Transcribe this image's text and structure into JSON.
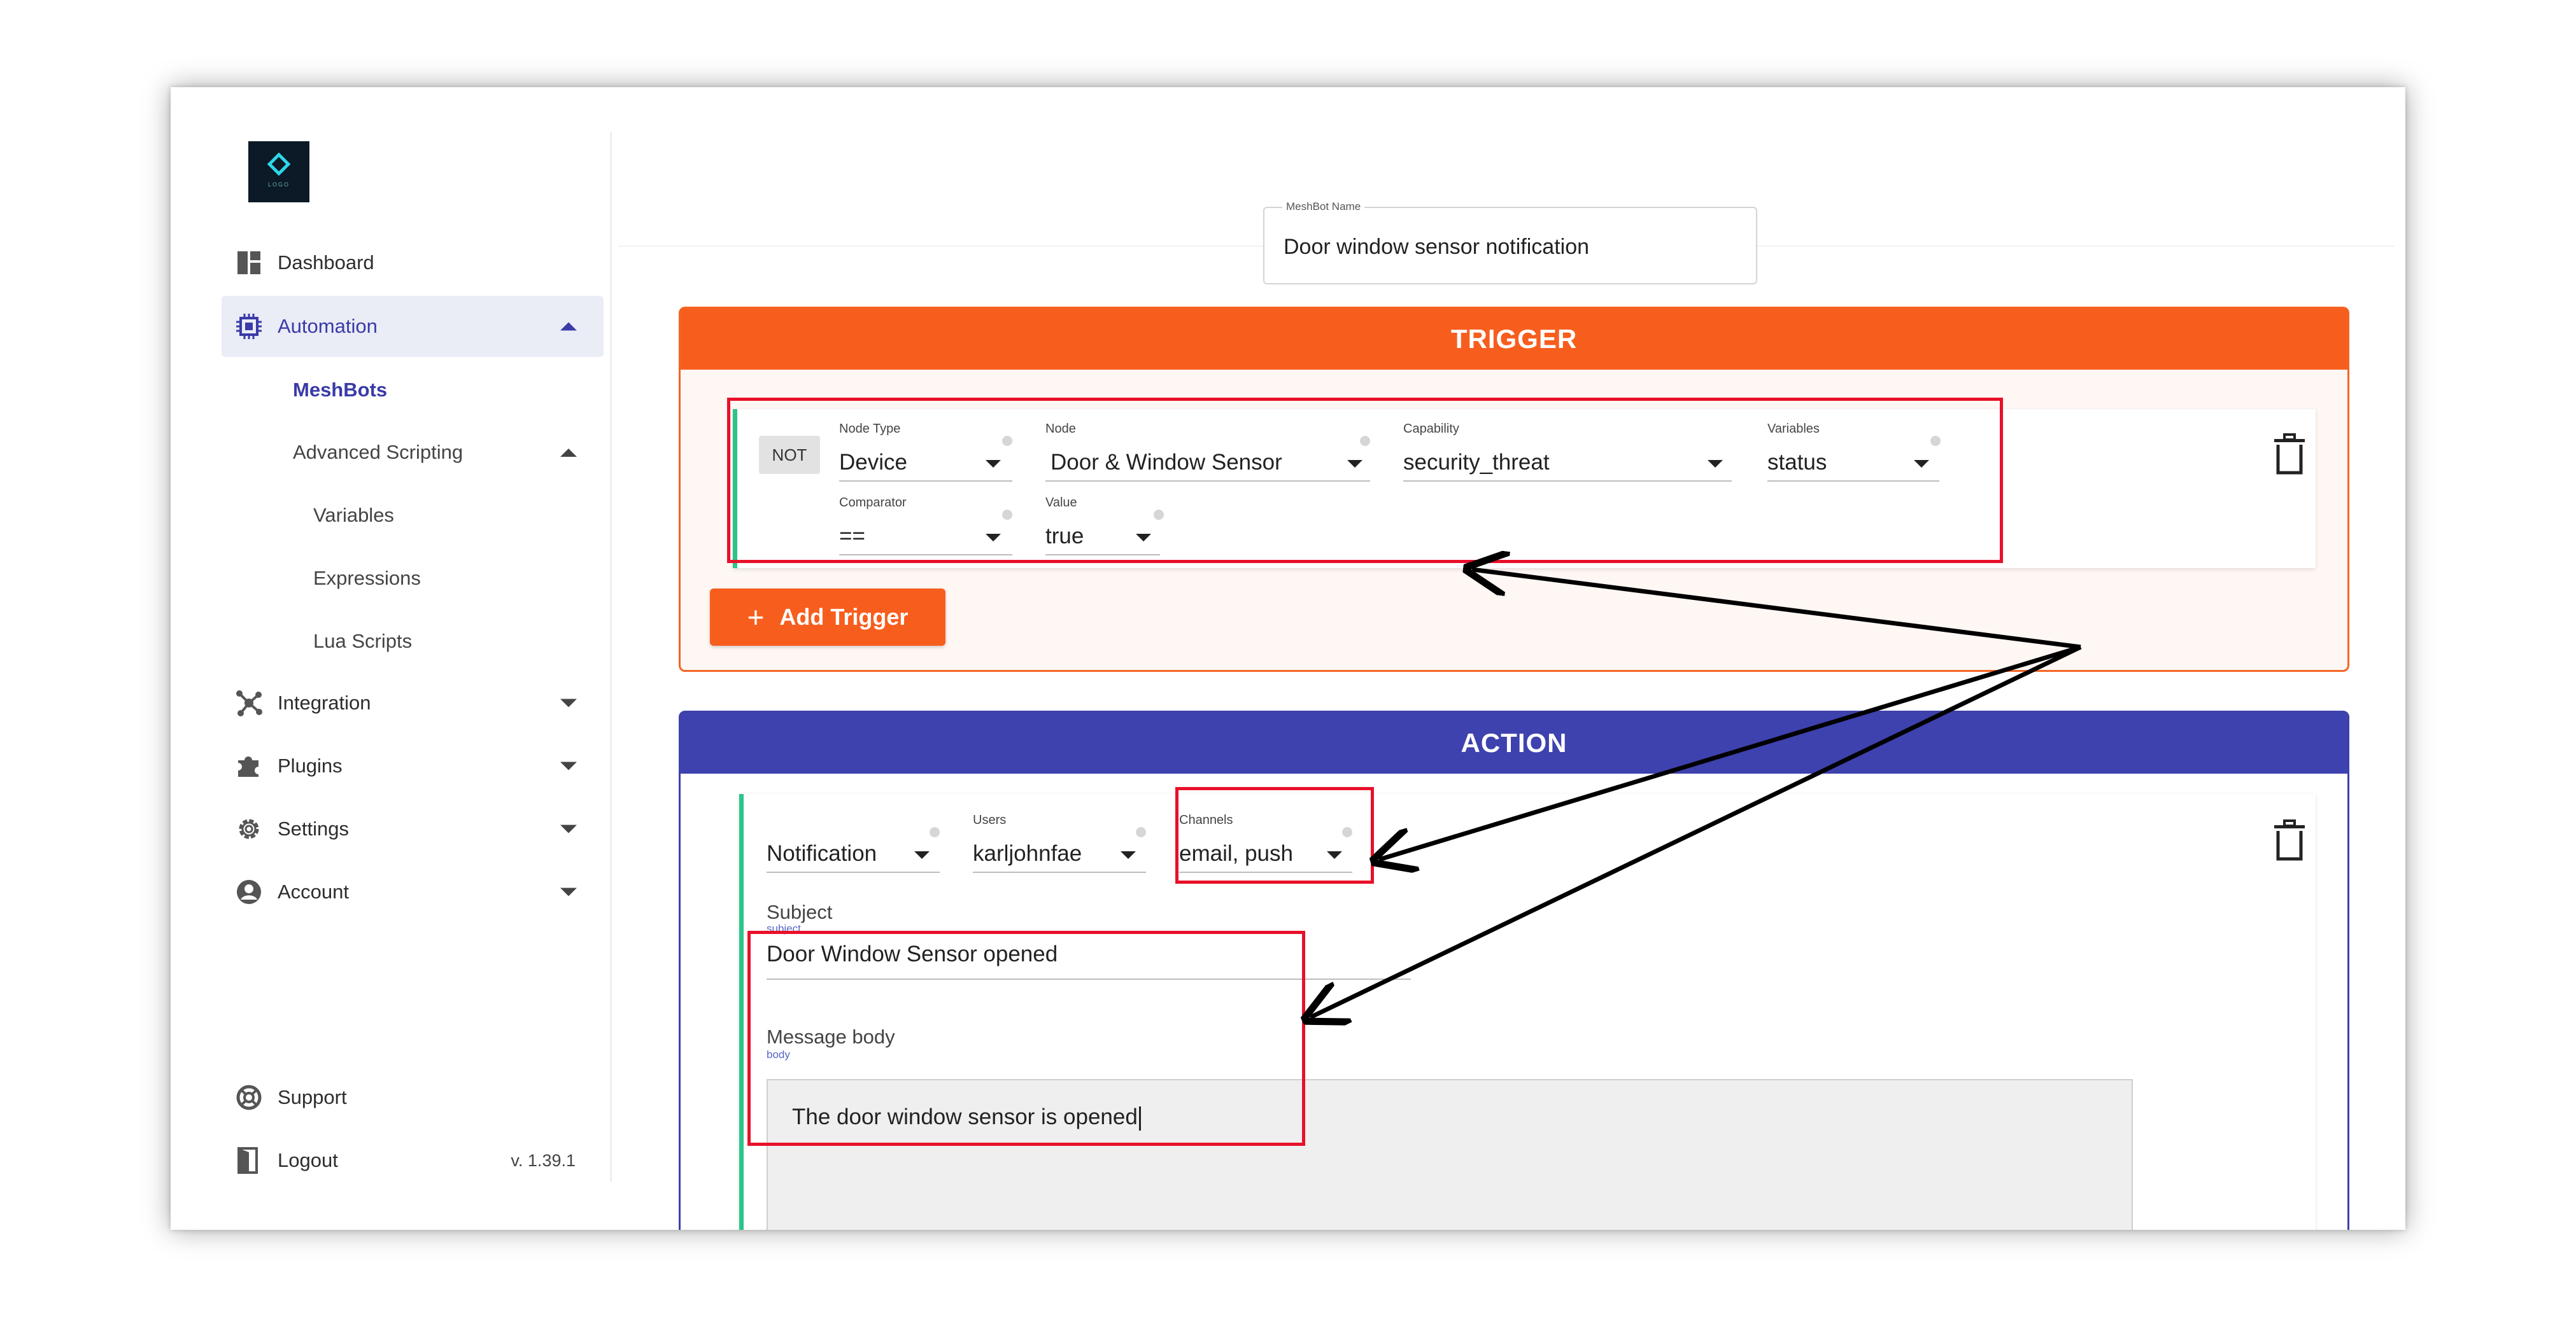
{
  "sidebar": {
    "logo_text": "LOGO",
    "nav": {
      "dashboard": "Dashboard",
      "automation": "Automation",
      "meshbots": "MeshBots",
      "advanced_scripting": "Advanced Scripting",
      "variables": "Variables",
      "expressions": "Expressions",
      "lua_scripts": "Lua Scripts",
      "integration": "Integration",
      "plugins": "Plugins",
      "settings": "Settings",
      "account": "Account",
      "support": "Support",
      "logout": "Logout"
    },
    "version": "v. 1.39.1"
  },
  "meshbot_name": {
    "label": "MeshBot Name",
    "value": "Door window sensor notification"
  },
  "trigger": {
    "title": "TRIGGER",
    "not_label": "NOT",
    "node_type": {
      "label": "Node Type",
      "value": "Device"
    },
    "node": {
      "label": "Node",
      "value": "Door & Window Sensor"
    },
    "capability": {
      "label": "Capability",
      "value": "security_threat"
    },
    "variables": {
      "label": "Variables",
      "value": "status"
    },
    "comparator": {
      "label": "Comparator",
      "value": "=="
    },
    "value": {
      "label": "Value",
      "value": "true"
    },
    "add_button": "Add Trigger"
  },
  "action": {
    "title": "ACTION",
    "type": {
      "value": "Notification"
    },
    "users": {
      "label": "Users",
      "value": "karljohnfae"
    },
    "channels": {
      "label": "Channels",
      "value": "email, push"
    },
    "subject": {
      "label": "Subject",
      "sublabel": "subject",
      "value": "Door Window Sensor opened"
    },
    "message_body": {
      "label": "Message body",
      "sublabel": "body",
      "value": "The door window sensor is opened"
    }
  },
  "colors": {
    "trigger_orange": "#f75e1e",
    "action_blue": "#3e42ae",
    "accent_green": "#2bc48a",
    "annotation_red": "#e8102a"
  }
}
